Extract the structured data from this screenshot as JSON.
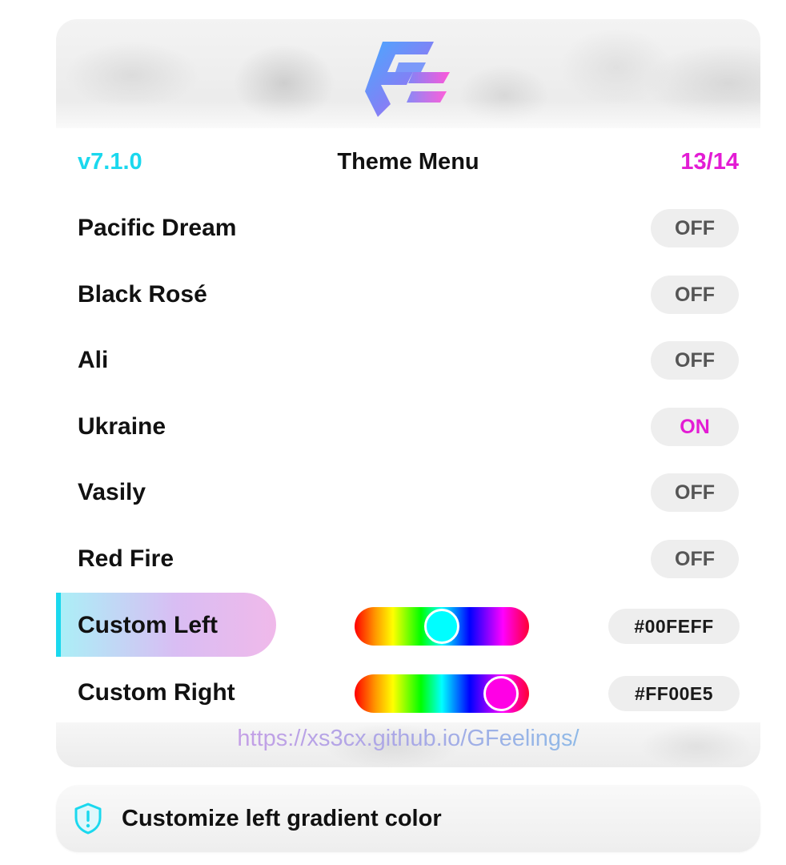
{
  "header": {
    "version": "v7.1.0",
    "title": "Theme Menu",
    "counter": "13/14"
  },
  "themes": [
    {
      "label": "Pacific Dream",
      "state": "OFF"
    },
    {
      "label": "Black Rosé",
      "state": "OFF"
    },
    {
      "label": "Ali",
      "state": "OFF"
    },
    {
      "label": "Ukraine",
      "state": "ON"
    },
    {
      "label": "Vasily",
      "state": "OFF"
    },
    {
      "label": "Red Fire",
      "state": "OFF"
    }
  ],
  "custom": {
    "left": {
      "label": "Custom Left",
      "hex": "#00FEFF",
      "hue_fraction": 0.5,
      "selected": true
    },
    "right": {
      "label": "Custom Right",
      "hex": "#FF00E5",
      "hue_fraction": 0.84,
      "selected": false
    }
  },
  "footer": {
    "link": "https://xs3cx.github.io/GFeelings/"
  },
  "tooltip": {
    "text": "Customize left gradient color",
    "icon": "shield-exclamation-icon"
  },
  "colors": {
    "accent_cyan": "#1ad8ee",
    "accent_magenta": "#e31cd4",
    "toggle_bg": "#eeeeee"
  }
}
